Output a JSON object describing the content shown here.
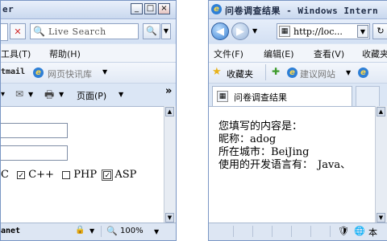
{
  "left_window": {
    "title": "er",
    "caption_buttons": [
      "_",
      "□",
      "×"
    ],
    "search_placeholder": "Live Search",
    "menu": {
      "tools": "工具(T)",
      "help": "帮助(H)"
    },
    "favbar": {
      "hotmail": "tmail",
      "quickstore": "网页快讯库"
    },
    "toolbar": {
      "page": "页面(P)",
      "more": "»"
    },
    "form": {
      "options": [
        {
          "label": "C",
          "checked": true
        },
        {
          "label": "C++",
          "checked": true
        },
        {
          "label": "PHP",
          "checked": false
        },
        {
          "label": "ASP",
          "checked": true
        }
      ]
    },
    "status": {
      "zone": "anet",
      "zoom": "100%"
    }
  },
  "right_window": {
    "title": "问卷调查结果 - Windows Intern",
    "address": "http://loc...",
    "menu": [
      "文件(F)",
      "编辑(E)",
      "查看(V)",
      "收藏夹"
    ],
    "favbar": {
      "favorites": "收藏夹",
      "suggested": "建议网站"
    },
    "tab_title": "问卷调查结果",
    "results": {
      "heading": "您填写的内容是：",
      "nickname_label": "昵称：",
      "nickname_value": "adog",
      "city_label": "所在城市：",
      "city_value": "BeiJing",
      "langs_label": "使用的开发语言有：",
      "langs_value": "Java、"
    },
    "status": {
      "zone": "本"
    }
  }
}
